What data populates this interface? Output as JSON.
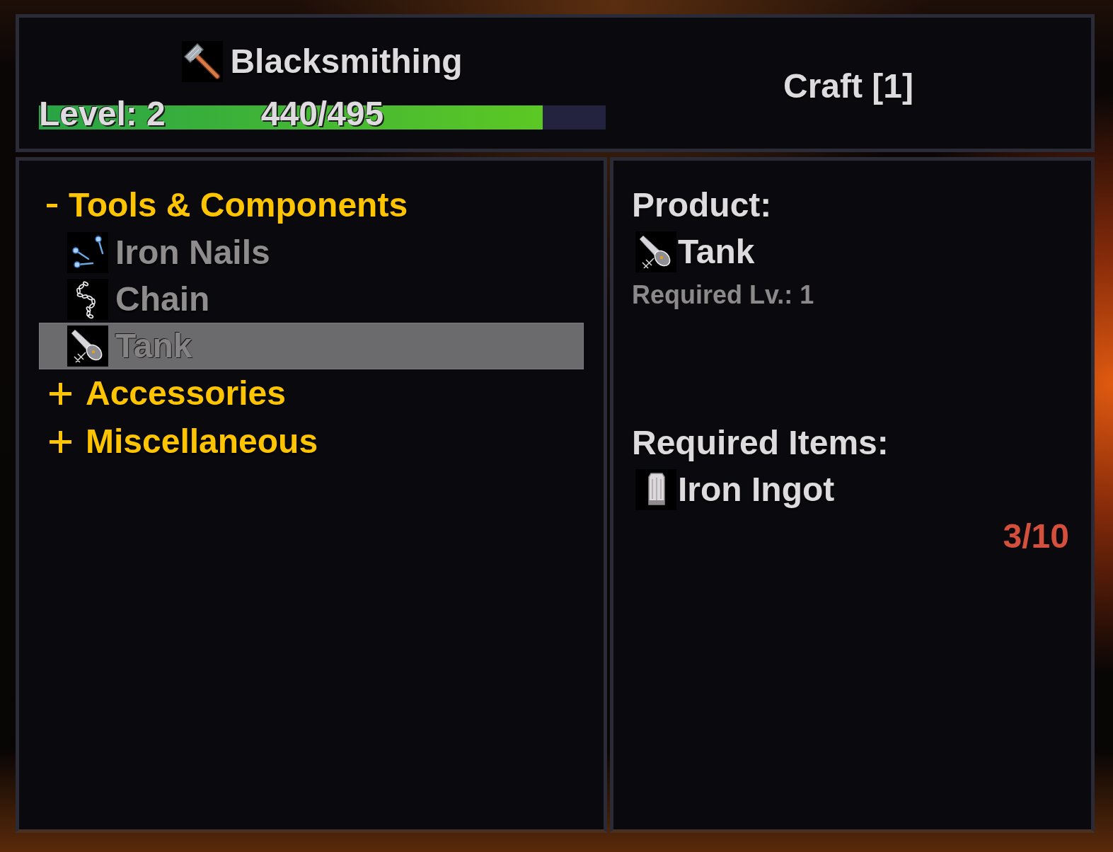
{
  "skill": {
    "title": "Blacksmithing",
    "level_label": "Level: 2",
    "xp": "440/495",
    "level": 0.889
  },
  "craft_button": {
    "label": "Craft [1]"
  },
  "categories": [
    {
      "label": "Tools & Components",
      "expanded": true,
      "children": [
        {
          "name": "Iron Nails",
          "kind": "nails",
          "selected": false
        },
        {
          "name": "Chain",
          "kind": "chain",
          "selected": false
        },
        {
          "name": "Tank",
          "kind": "tank",
          "selected": true
        }
      ]
    },
    {
      "label": "Accessories",
      "expanded": false
    },
    {
      "label": "Miscellaneous",
      "expanded": false
    }
  ],
  "details": {
    "product_heading": "Product:",
    "product": {
      "name": "Tank",
      "kind": "tank"
    },
    "required_level": "Required Lv.: 1",
    "items_heading": "Required Items:",
    "items": [
      {
        "name": "Iron Ingot",
        "kind": "ingot",
        "count": "3/10",
        "sufficient": false
      }
    ]
  }
}
